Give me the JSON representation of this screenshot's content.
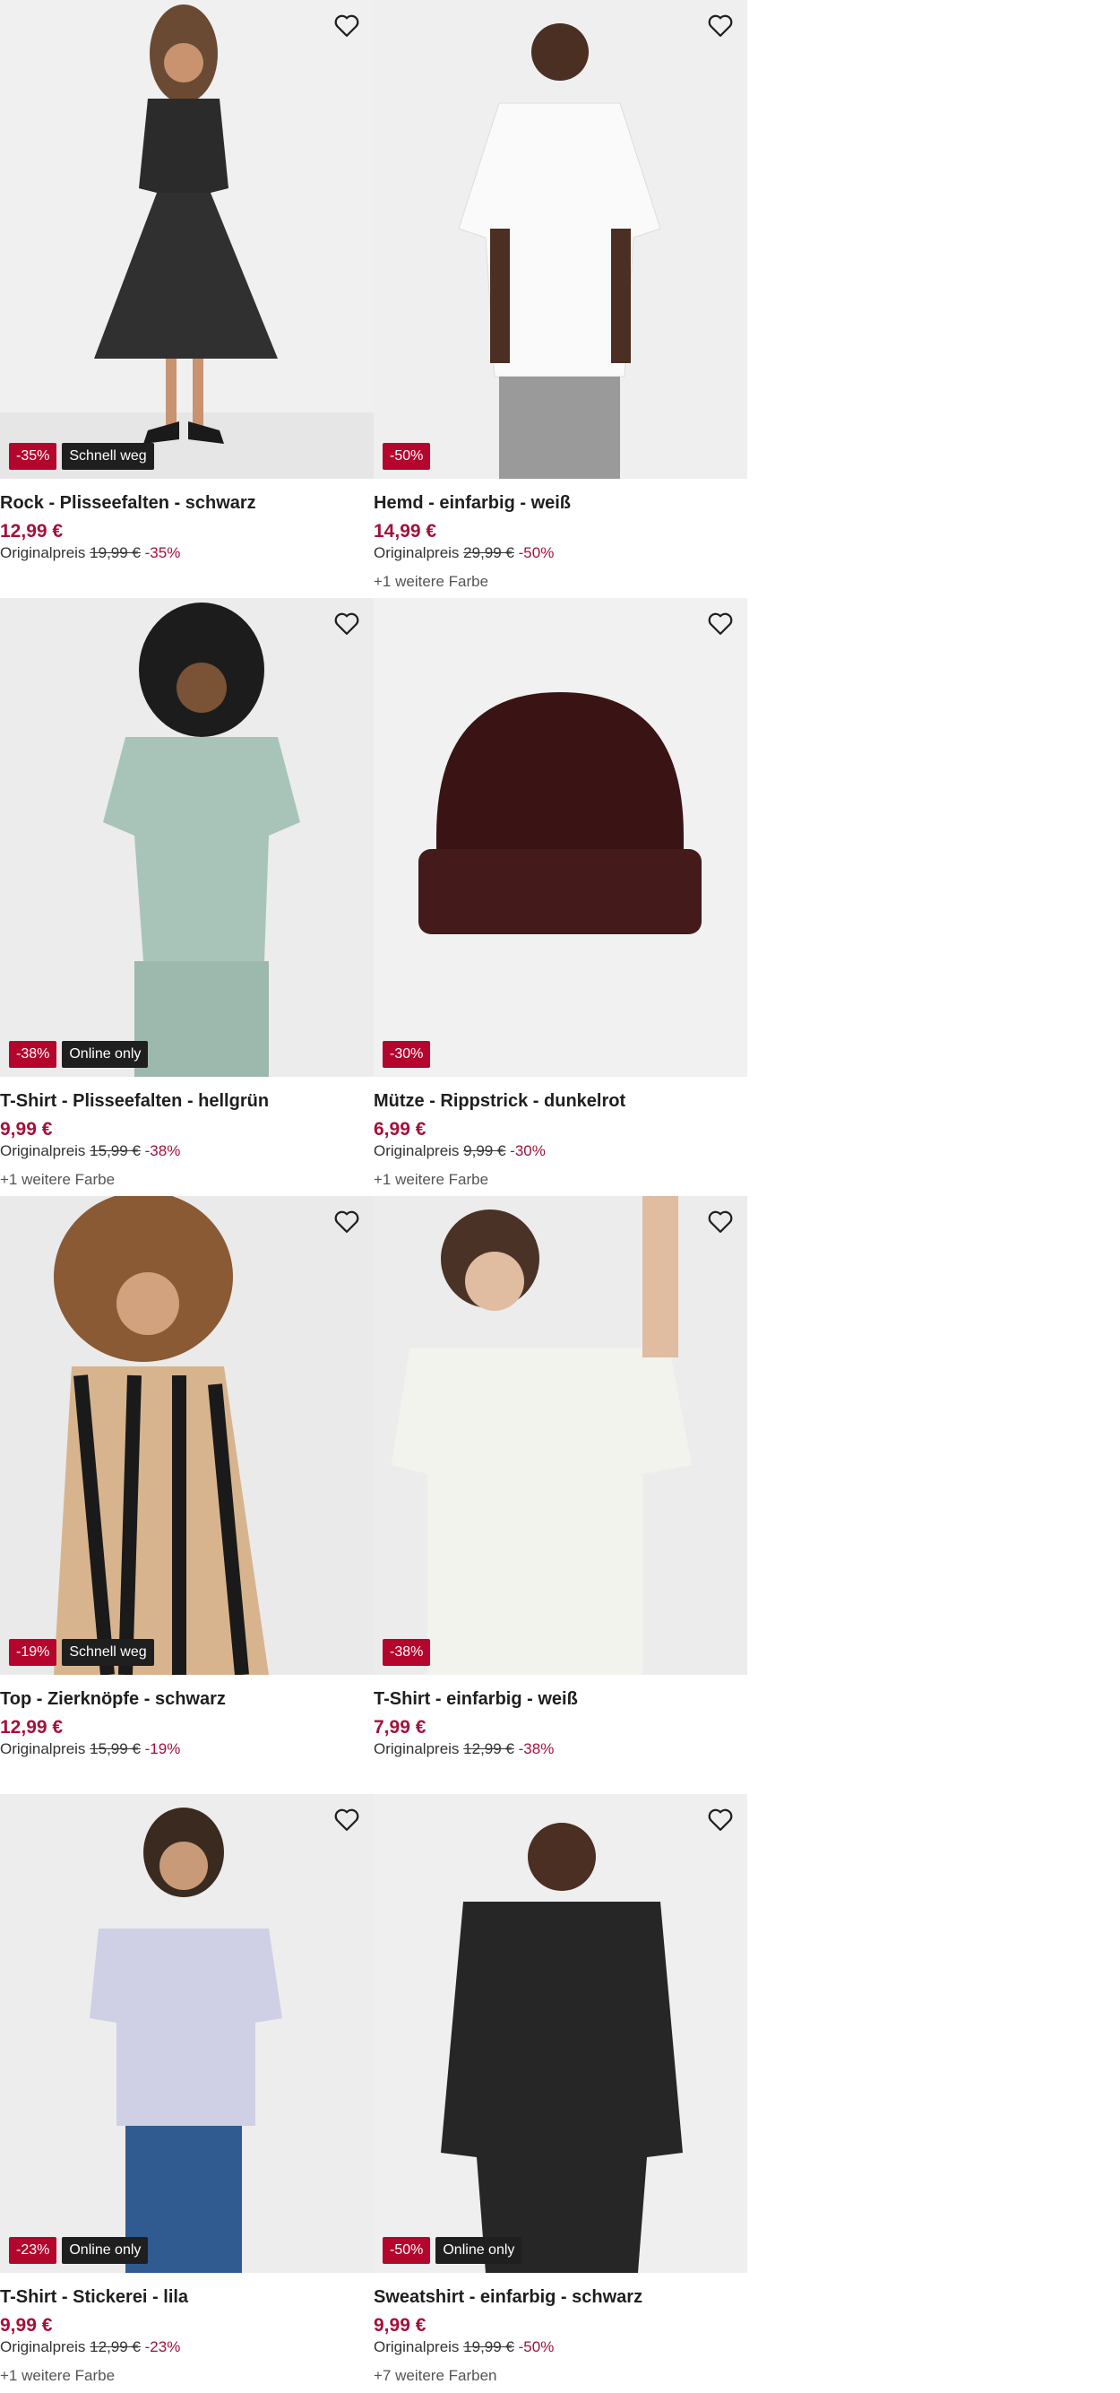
{
  "products": [
    {
      "title": "Rock - Plisseefalten - schwarz",
      "price": "12,99 €",
      "orig_label": "Originalpreis",
      "orig_price": "19,99 €",
      "orig_pct": "-35%",
      "badge_discount": "-35%",
      "badge_label": "Schnell weg",
      "colors": "",
      "image_icon": "woman-skirt-black-photo"
    },
    {
      "title": "Hemd - einfarbig - weiß",
      "price": "14,99 €",
      "orig_label": "Originalpreis",
      "orig_price": "29,99 €",
      "orig_pct": "-50%",
      "badge_discount": "-50%",
      "badge_label": "",
      "colors": "+1 weitere Farbe",
      "image_icon": "man-shirt-white-photo"
    },
    {
      "title": "T-Shirt - Plisseefalten - hellgrün",
      "price": "9,99 €",
      "orig_label": "Originalpreis",
      "orig_price": "15,99 €",
      "orig_pct": "-38%",
      "badge_discount": "-38%",
      "badge_label": "Online only",
      "colors": "+1 weitere Farbe",
      "image_icon": "woman-tshirt-green-photo"
    },
    {
      "title": "Mütze - Rippstrick - dunkelrot",
      "price": "6,99 €",
      "orig_label": "Originalpreis",
      "orig_price": "9,99 €",
      "orig_pct": "-30%",
      "badge_discount": "-30%",
      "badge_label": "",
      "colors": "+1 weitere Farbe",
      "image_icon": "beanie-darkred-photo"
    },
    {
      "title": "Top - Zierknöpfe - schwarz",
      "price": "12,99 €",
      "orig_label": "Originalpreis",
      "orig_price": "15,99 €",
      "orig_pct": "-19%",
      "badge_discount": "-19%",
      "badge_label": "Schnell weg",
      "colors": "",
      "image_icon": "woman-top-pattern-photo"
    },
    {
      "title": "T-Shirt - einfarbig - weiß",
      "price": "7,99 €",
      "orig_label": "Originalpreis",
      "orig_price": "12,99 €",
      "orig_pct": "-38%",
      "badge_discount": "-38%",
      "badge_label": "",
      "colors": "",
      "image_icon": "woman-tshirt-white-photo"
    },
    {
      "title": "T-Shirt - Stickerei - lila",
      "price": "9,99 €",
      "orig_label": "Originalpreis",
      "orig_price": "12,99 €",
      "orig_pct": "-23%",
      "badge_discount": "-23%",
      "badge_label": "Online only",
      "colors": "+1 weitere Farbe",
      "image_icon": "woman-tshirt-lilac-photo"
    },
    {
      "title": "Sweatshirt - einfarbig - schwarz",
      "price": "9,99 €",
      "orig_label": "Originalpreis",
      "orig_price": "19,99 €",
      "orig_pct": "-50%",
      "badge_discount": "-50%",
      "badge_label": "Online only",
      "colors": "+7 weitere Farben",
      "image_icon": "man-sweatshirt-black-photo"
    }
  ],
  "colors": {
    "price": "#a3113a",
    "discount_badge": "#b4052d",
    "label_badge": "#1f1f1f",
    "image_bg": "#efefef"
  },
  "icons": {
    "wishlist": "heart-outline-icon"
  }
}
